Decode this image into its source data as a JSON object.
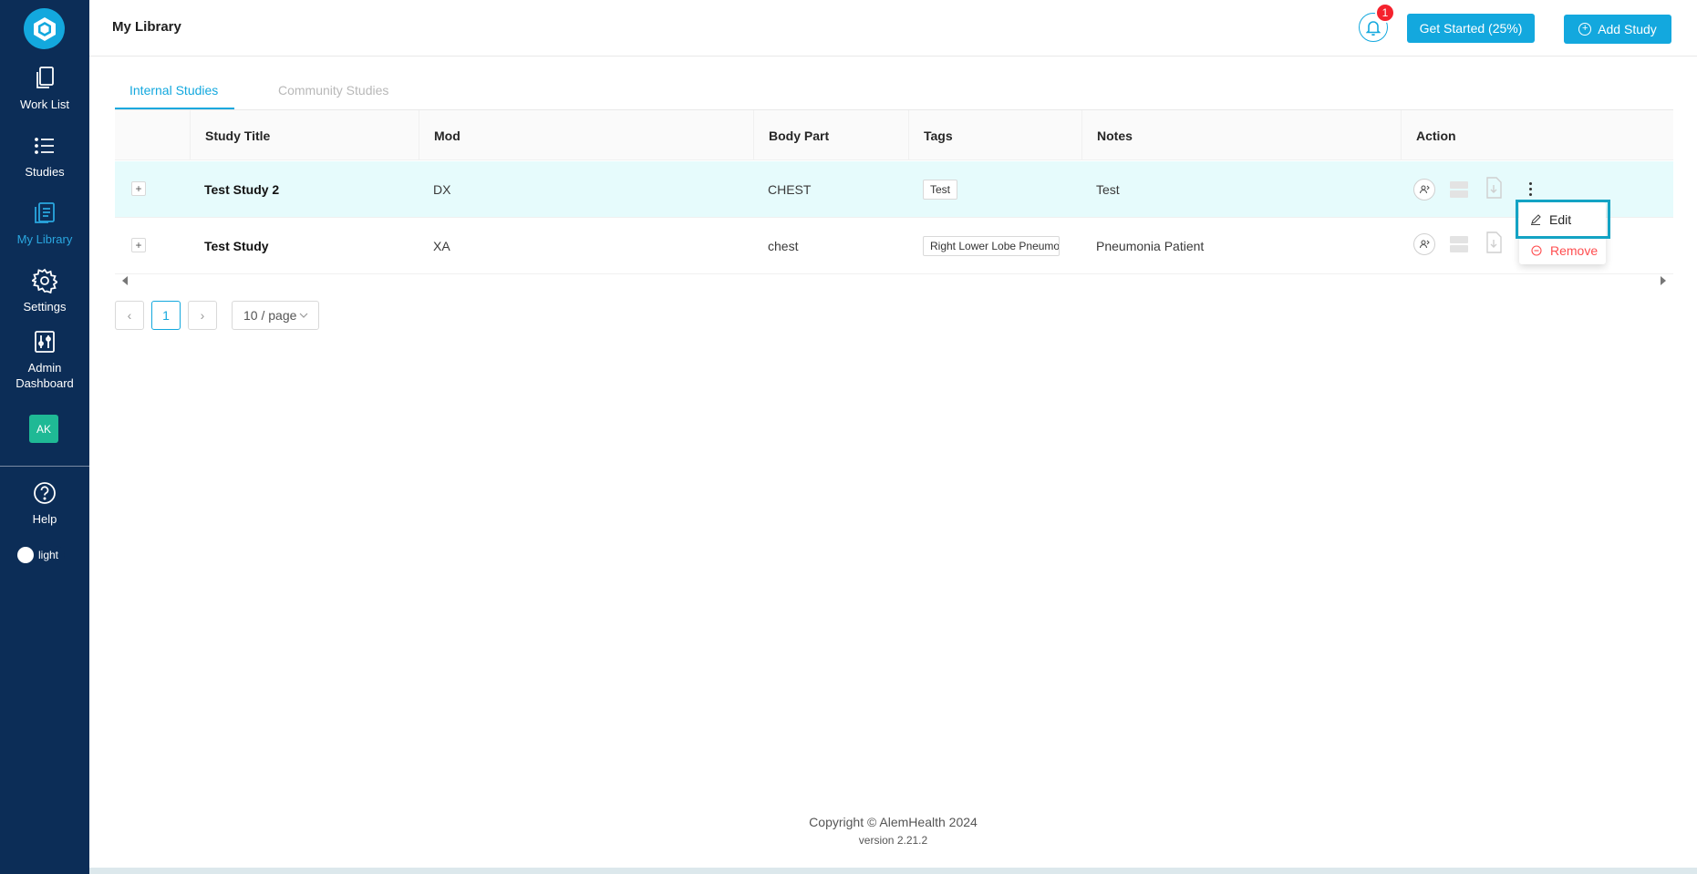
{
  "sidebar": {
    "items": [
      {
        "label": "Work List",
        "icon": "copy-icon"
      },
      {
        "label": "Studies",
        "icon": "list-icon"
      },
      {
        "label": "My Library",
        "icon": "library-icon"
      },
      {
        "label": "Settings",
        "icon": "gear-icon"
      },
      {
        "label": "Admin Dashboard",
        "icon": "sliders-icon"
      }
    ],
    "avatar": "AK",
    "help": "Help",
    "theme": "light"
  },
  "header": {
    "title": "My Library",
    "notification_count": "1",
    "get_started": "Get Started (25%)",
    "add_study": "Add Study"
  },
  "tabs": [
    {
      "label": "Internal Studies",
      "active": true
    },
    {
      "label": "Community Studies",
      "active": false
    }
  ],
  "table": {
    "columns": [
      "Study Title",
      "Mod",
      "Body Part",
      "Tags",
      "Notes",
      "Action"
    ],
    "rows": [
      {
        "title": "Test Study 2",
        "mod": "DX",
        "body_part": "CHEST",
        "tag": "Test",
        "notes": "Test"
      },
      {
        "title": "Test Study",
        "mod": "XA",
        "body_part": "chest",
        "tag": "Right Lower Lobe Pneumonia",
        "notes": "Pneumonia Patient"
      }
    ]
  },
  "pagination": {
    "current": "1",
    "page_size": "10 / page"
  },
  "dropdown": {
    "edit": "Edit",
    "remove": "Remove"
  },
  "footer": {
    "copyright": "Copyright © AlemHealth 2024",
    "version": "version 2.21.2"
  },
  "colors": {
    "sidebar": "#0c2d57",
    "accent": "#13a8de",
    "danger": "#ff4d4f",
    "selected_row": "#e6fbfc"
  }
}
